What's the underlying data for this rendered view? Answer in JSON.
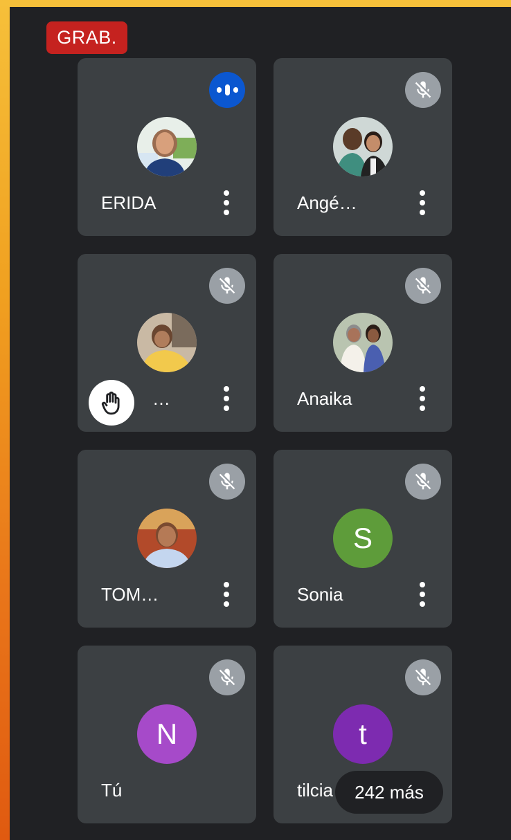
{
  "recording_badge": "GRAB.",
  "participants": [
    {
      "name": "ERIDA",
      "status": "speaking",
      "avatar_type": "photo"
    },
    {
      "name": "Angé…",
      "status": "muted",
      "avatar_type": "photo"
    },
    {
      "name": "…",
      "status": "muted",
      "avatar_type": "photo",
      "hand_raised": true
    },
    {
      "name": "Anaika",
      "status": "muted",
      "avatar_type": "photo"
    },
    {
      "name": "TOM…",
      "status": "muted",
      "avatar_type": "photo"
    },
    {
      "name": "Sonia",
      "status": "muted",
      "avatar_type": "letter",
      "initial": "S",
      "color": "#5e9c3a"
    },
    {
      "name": "Tú",
      "status": "muted",
      "avatar_type": "letter",
      "initial": "N",
      "color": "#a64ac9"
    },
    {
      "name": "tilcia",
      "status": "muted",
      "avatar_type": "letter",
      "initial": "t",
      "color": "#7d2bb0"
    }
  ],
  "overflow": {
    "label": "242 más"
  },
  "icons": {
    "muted": "mic-off-icon",
    "speaking": "audio-level-icon",
    "more": "more-vert-icon",
    "hand": "raised-hand-icon"
  },
  "colors": {
    "tile_bg": "#3c4043",
    "screen_bg": "#202124",
    "rec_red": "#c5221f",
    "speaking_blue": "#0b57d0",
    "muted_grey": "#9aa0a6"
  }
}
